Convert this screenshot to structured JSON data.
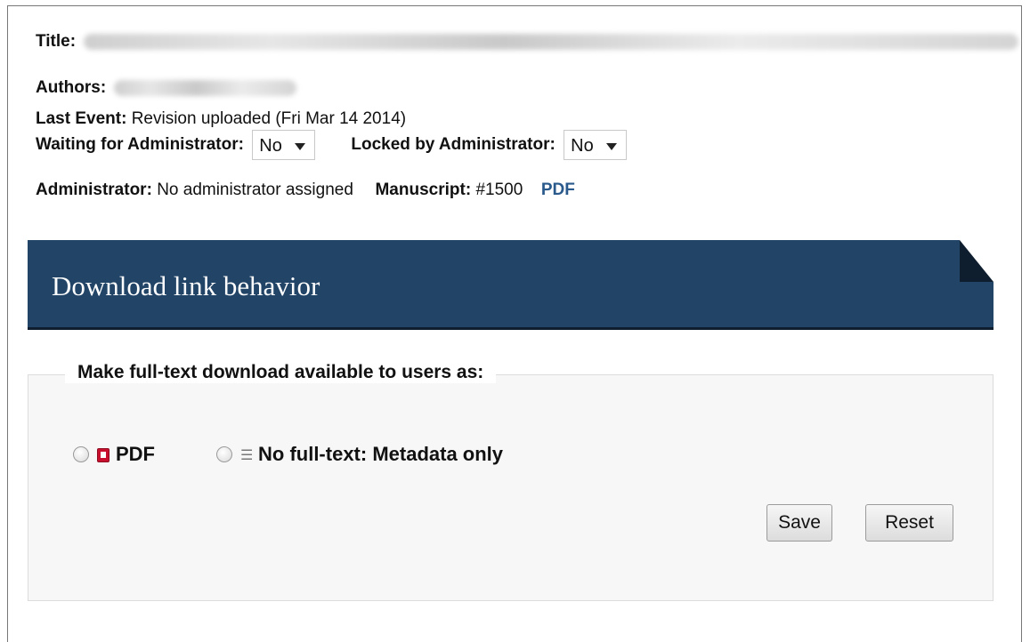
{
  "header": {
    "title_label": "Title:",
    "authors_label": "Authors:",
    "last_event_label": "Last Event:",
    "last_event_value": "Revision uploaded (Fri Mar 14 2014)",
    "waiting_label": "Waiting for Administrator:",
    "waiting_value": "No",
    "locked_label": "Locked by Administrator:",
    "locked_value": "No",
    "administrator_label": "Administrator:",
    "administrator_value": "No administrator assigned",
    "manuscript_label": "Manuscript:",
    "manuscript_value": "#1500",
    "pdf_link": "PDF"
  },
  "section": {
    "title": "Download link behavior",
    "legend": "Make full-text download available to users as:",
    "options": [
      {
        "label": "PDF",
        "icon": "pdf-icon"
      },
      {
        "label": "No full-text: Metadata only",
        "icon": "list-icon"
      }
    ],
    "save_label": "Save",
    "reset_label": "Reset"
  },
  "colors": {
    "banner": "#224466",
    "link": "#2a5a8c"
  }
}
